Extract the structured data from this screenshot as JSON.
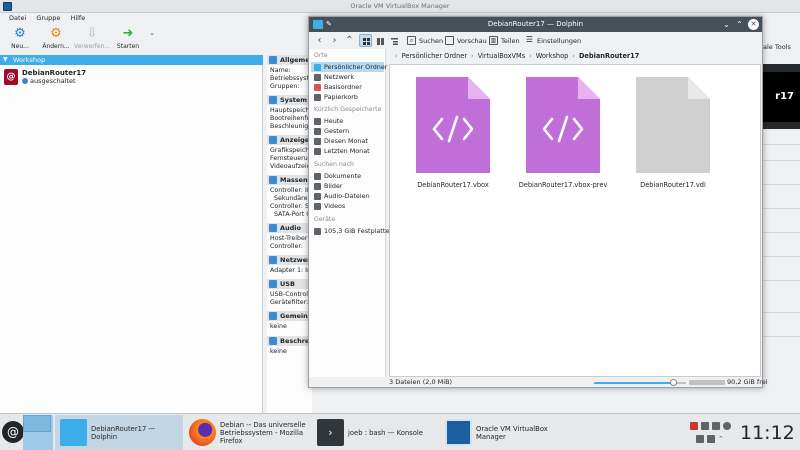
{
  "vbox": {
    "title": "Oracle VM VirtualBox Manager",
    "menu": [
      "Datei",
      "Gruppe",
      "Hilfe"
    ],
    "toolbar": {
      "new": "Neu...",
      "change": "Ändern...",
      "discard": "Verwerfen...",
      "start": "Starten",
      "tools_suffix": "ale Tools"
    },
    "group": "Workshop",
    "vm": {
      "name": "DebianRouter17",
      "state": "ausgeschaltet"
    },
    "details": {
      "general": {
        "title": "Allgemein",
        "rows": [
          "Name:",
          "Betriebssystem",
          "Gruppen:"
        ]
      },
      "system": {
        "title": "System",
        "rows": [
          "Hauptspeicher",
          "Bootreihenfolge",
          "Beschleunigung"
        ]
      },
      "display": {
        "title": "Anzeige",
        "rows": [
          "Grafikspeicher",
          "Fernsteuerung",
          "Videoaufzeichnung"
        ]
      },
      "storage": {
        "title": "Massenspeicher",
        "rows": [
          "Controller: IDE",
          "Sekundärer M",
          "Controller: SA",
          "SATA-Port 0:"
        ]
      },
      "audio": {
        "title": "Audio",
        "rows": [
          "Host-Treiber:",
          "Controller:"
        ]
      },
      "network": {
        "title": "Netzwerk",
        "rows": [
          "Adapter 1:   In"
        ]
      },
      "usb": {
        "title": "USB",
        "rows": [
          "USB-Controller",
          "Gerätefilter:"
        ]
      },
      "shared": {
        "title": "Gemeinsame",
        "rows": [
          "keine"
        ]
      },
      "description": {
        "title": "Beschreibung",
        "rows": [
          "keine"
        ]
      }
    },
    "preview_text": "r17"
  },
  "dolphin": {
    "title": "DebianRouter17 — Dolphin",
    "toolbar": {
      "search": "Suchen",
      "preview": "Vorschau",
      "split": "Teilen",
      "settings": "Einstellungen"
    },
    "places": {
      "heading_places": "Orte",
      "places": [
        "Persönlicher Ordner",
        "Netzwerk",
        "Basisordner",
        "Papierkorb"
      ],
      "heading_recent": "Kürzlich Gespeicherte",
      "recent": [
        "Heute",
        "Gestern",
        "Diesen Monat",
        "Letzten Monat"
      ],
      "heading_search": "Suchen nach",
      "search": [
        "Dokumente",
        "Bilder",
        "Audio-Dateien",
        "Videos"
      ],
      "heading_devices": "Geräte",
      "devices": [
        "105,3 GiB Festplatte"
      ]
    },
    "breadcrumb": [
      "Persönlicher Ordner",
      "VirtualBoxVMs",
      "Workshop",
      "DebianRouter17"
    ],
    "files": [
      {
        "name": "DebianRouter17.vbox",
        "kind": "xml"
      },
      {
        "name": "DebianRouter17.vbox-prev",
        "kind": "xml"
      },
      {
        "name": "DebianRouter17.vdi",
        "kind": "generic"
      }
    ],
    "status": {
      "count": "3 Dateien (2,0 MiB)",
      "free": "90,2 GiB frei"
    },
    "colors": {
      "xml_file": "#c06fd8",
      "xml_fold": "#e6b3f0",
      "generic_file": "#cfcfcf",
      "generic_fold": "#e8e8e8",
      "accent": "#3daee9"
    }
  },
  "taskbar": {
    "tasks": [
      {
        "label": "DebianRouter17 — Dolphin"
      },
      {
        "label1": "Debian -- Das universelle",
        "label2": "Betriebssystem - Mozilla Firefox"
      },
      {
        "label": "joeb : bash — Konsole"
      },
      {
        "label": "Oracle VM VirtualBox Manager"
      }
    ],
    "clock": "11:12"
  }
}
